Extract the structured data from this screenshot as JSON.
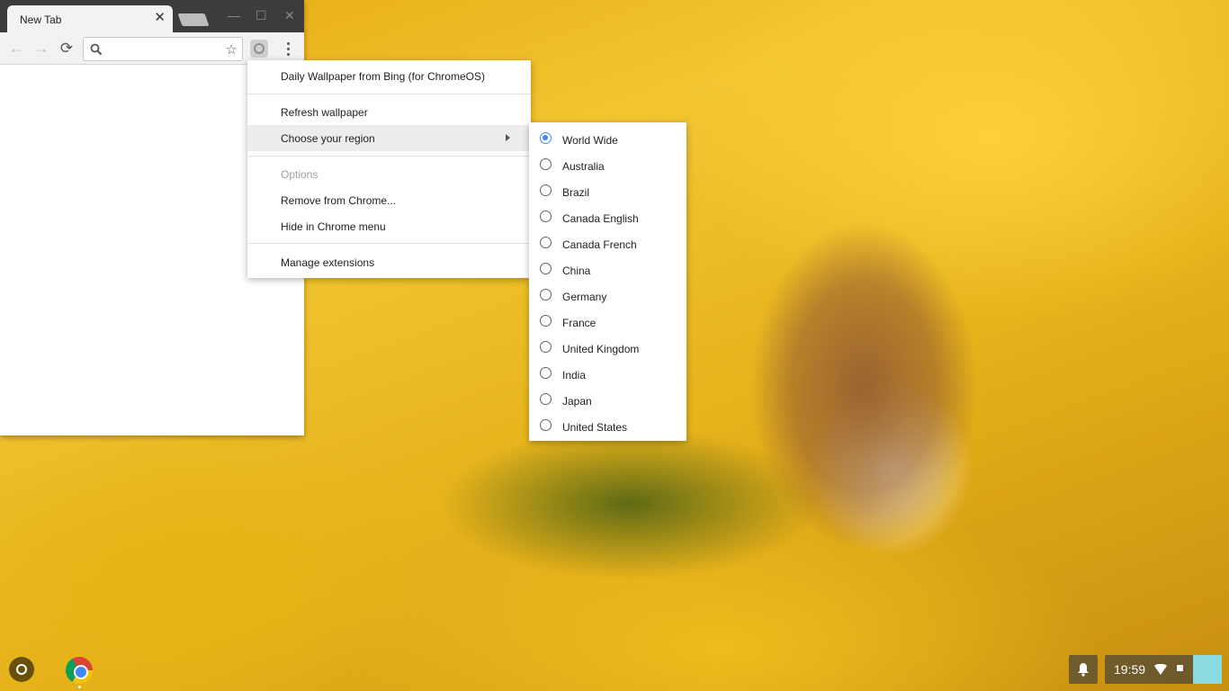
{
  "browser": {
    "tab_title": "New Tab",
    "tab_close": "✕",
    "window_minimize": "—",
    "window_maximize": "☐",
    "window_close": "✕",
    "back_icon": "←",
    "forward_icon": "→",
    "reload_icon": "⟳",
    "search_icon": "🔍",
    "star_icon": "☆",
    "omnibox_value": ""
  },
  "menu": {
    "header": "Daily Wallpaper from Bing (for ChromeOS)",
    "items": [
      {
        "label": "Refresh wallpaper"
      },
      {
        "label": "Choose your region"
      },
      {
        "label": "Options"
      },
      {
        "label": "Remove from Chrome..."
      },
      {
        "label": "Hide in Chrome menu"
      },
      {
        "label": "Manage extensions"
      }
    ]
  },
  "regions": {
    "selected": "World Wide",
    "items": [
      "World Wide",
      "Australia",
      "Brazil",
      "Canada English",
      "Canada French",
      "China",
      "Germany",
      "France",
      "United Kingdom",
      "India",
      "Japan",
      "United States"
    ]
  },
  "shelf": {
    "bell_icon": "🔔",
    "clock": "19:59",
    "wifi_icon": "▼"
  },
  "colors": {
    "accent": "#4285f4",
    "tray_avatar": "#8adbe0"
  }
}
